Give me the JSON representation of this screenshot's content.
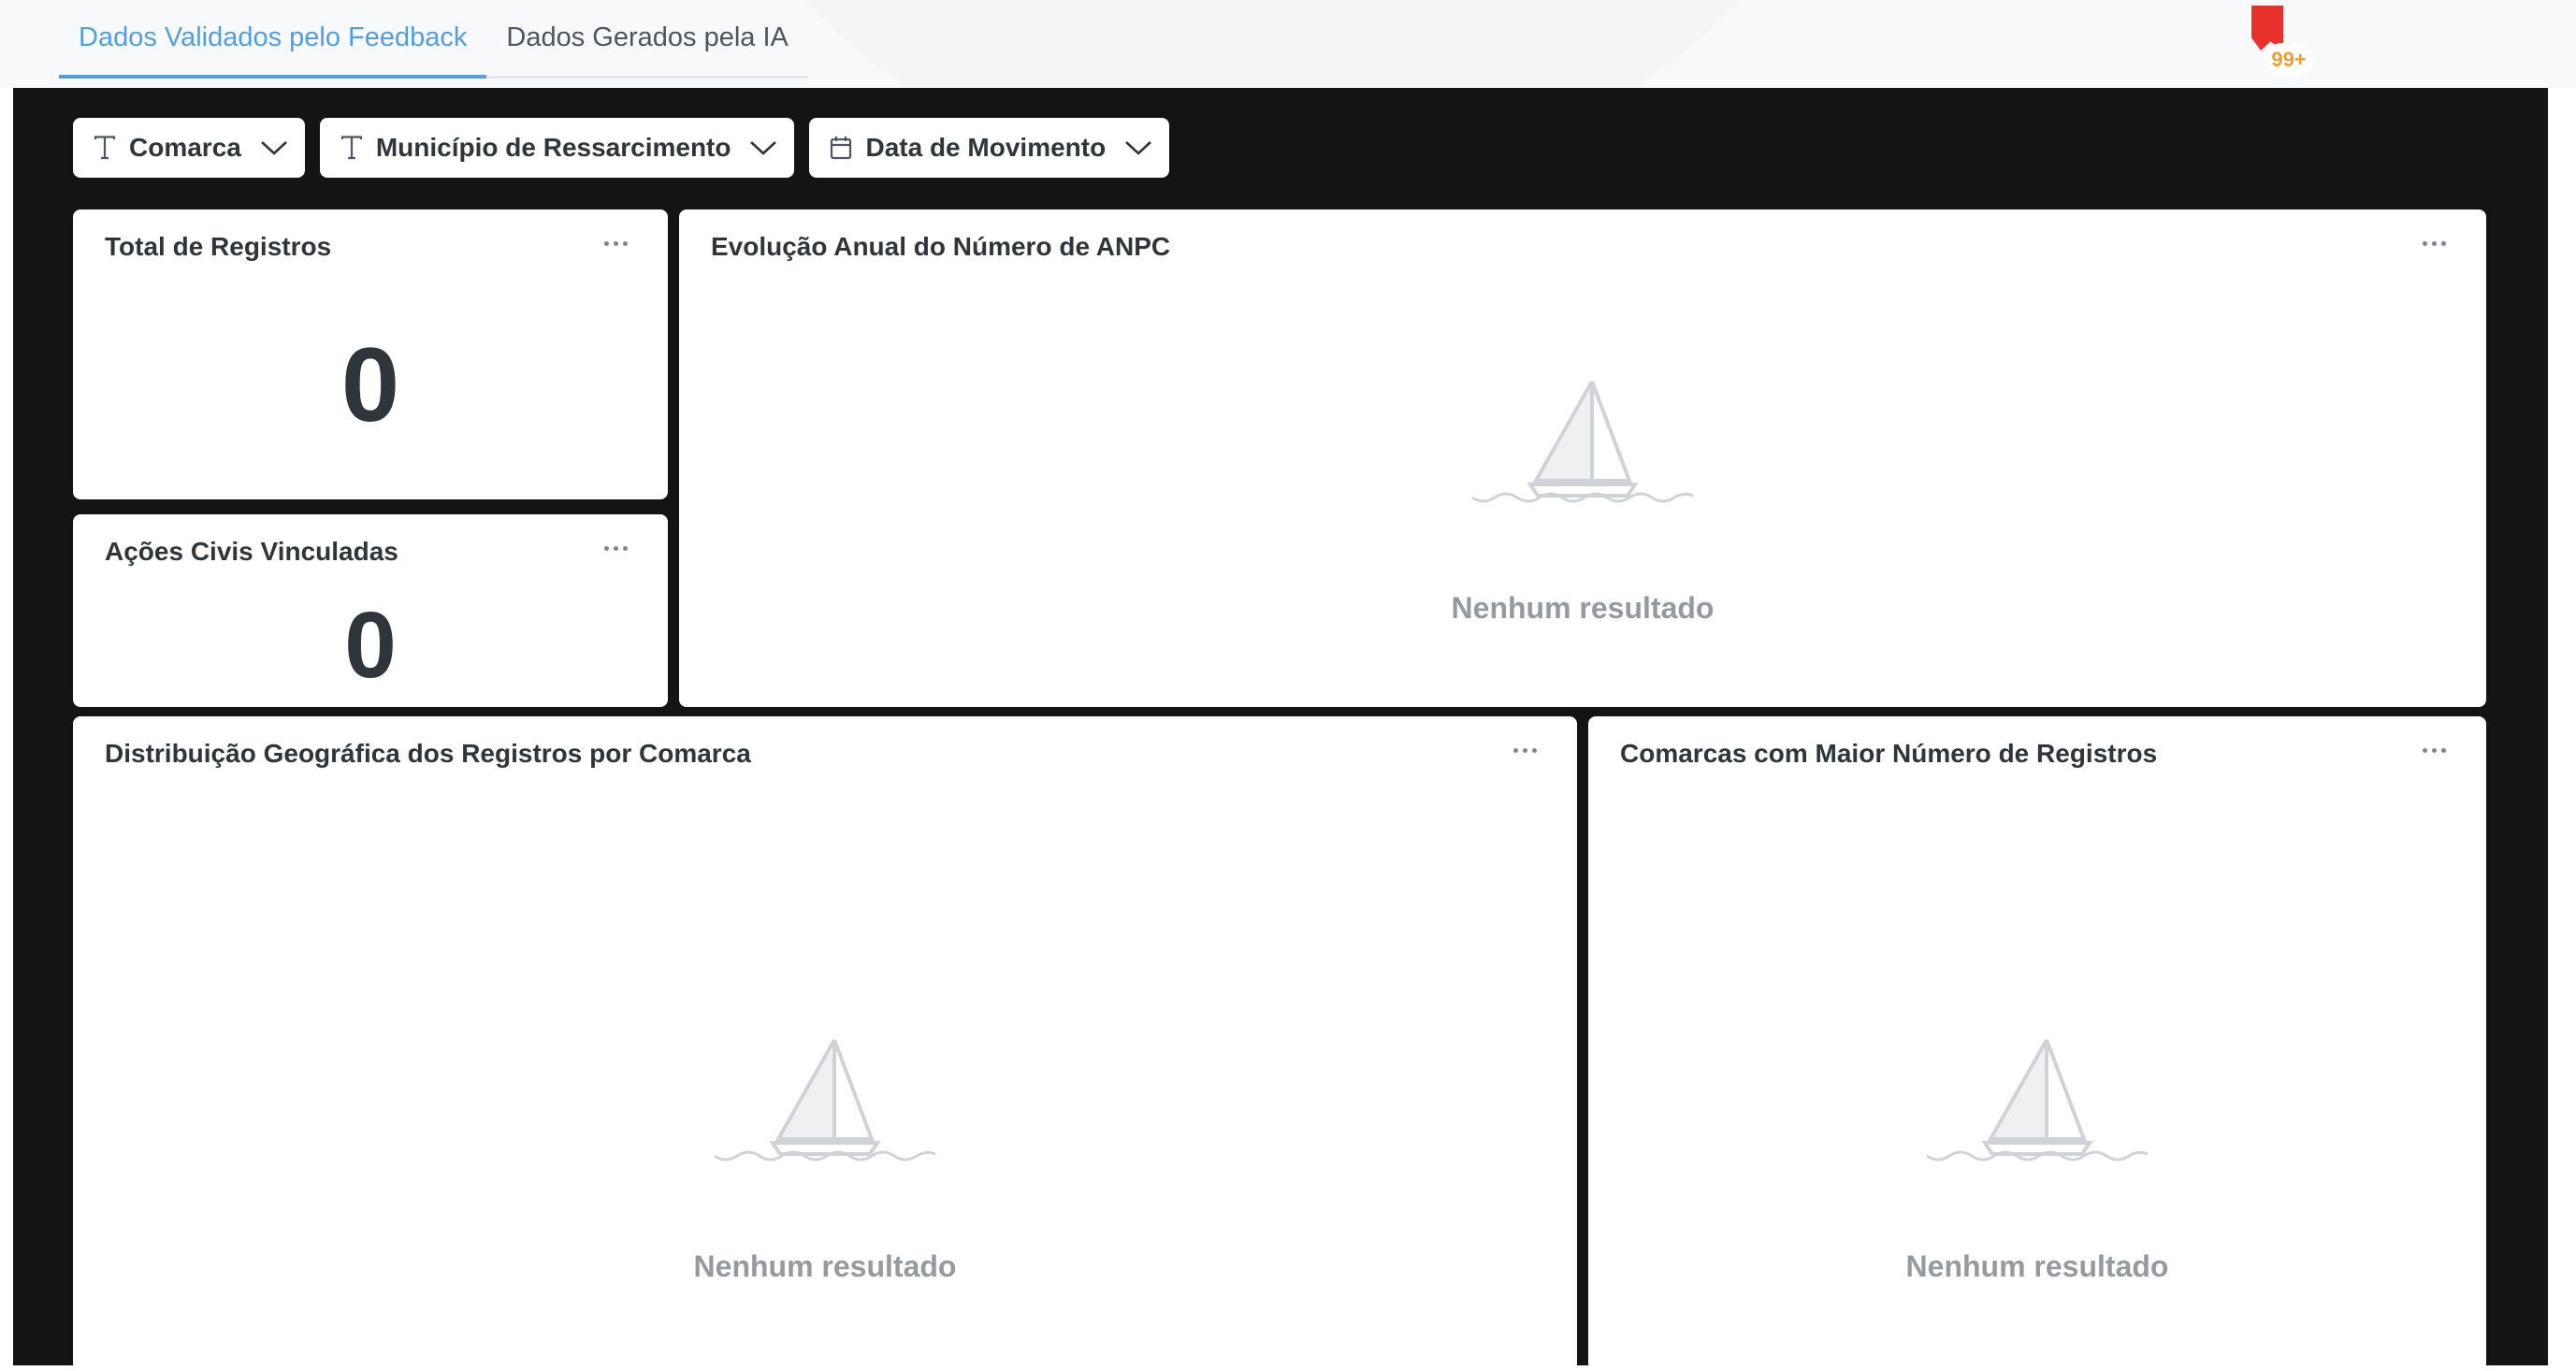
{
  "tabs": [
    {
      "label": "Dados Validados pelo Feedback",
      "active": true
    },
    {
      "label": "Dados Gerados pela IA",
      "active": false
    }
  ],
  "notifications": {
    "badge": "99+"
  },
  "filters": [
    {
      "label": "Comarca",
      "icon": "text-type-icon"
    },
    {
      "label": "Município de Ressarcimento",
      "icon": "text-type-icon"
    },
    {
      "label": "Data de Movimento",
      "icon": "calendar-icon"
    }
  ],
  "cards": {
    "total_registros": {
      "title": "Total de Registros",
      "value": "0"
    },
    "acoes_civis": {
      "title": "Ações Civis Vinculadas",
      "value": "0"
    },
    "evolucao_anual": {
      "title": "Evolução Anual do Número de ANPC",
      "empty_text": "Nenhum resultado"
    },
    "distribuicao_geografica": {
      "title": "Distribuição Geográfica dos Registros por Comarca",
      "empty_text": "Nenhum resultado"
    },
    "comarcas_maior": {
      "title": "Comarcas com Maior Número de Registros",
      "empty_text": "Nenhum resultado"
    }
  },
  "colors": {
    "accent": "#509ee3",
    "notification": "#e8312a",
    "background": "#141414"
  }
}
